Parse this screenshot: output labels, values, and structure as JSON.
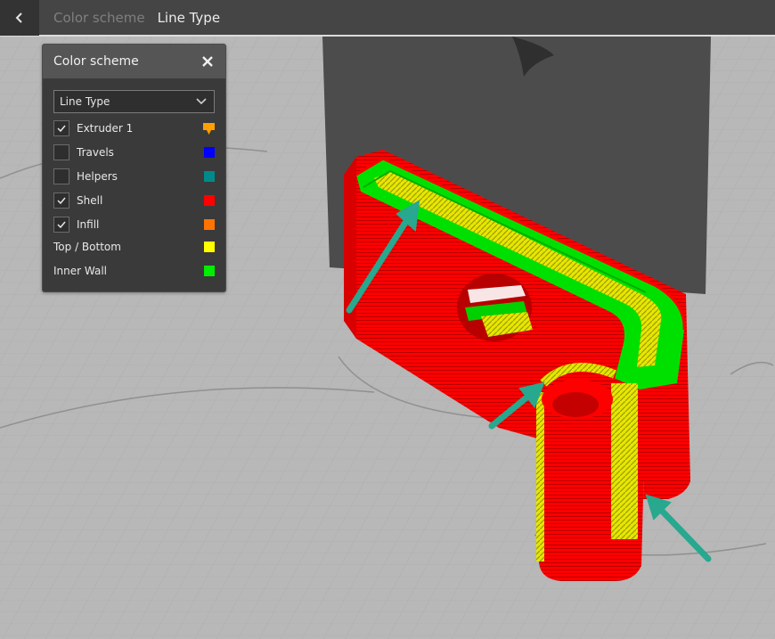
{
  "breadcrumb": {
    "parent": "Color scheme",
    "current": "Line Type"
  },
  "panel": {
    "title": "Color scheme",
    "dropdown_value": "Line Type",
    "items": [
      {
        "label": "Extruder 1",
        "checked": true,
        "color": "#ff9f00",
        "icon": "extruder-flag-icon"
      },
      {
        "label": "Travels",
        "checked": false,
        "color": "#0000ff"
      },
      {
        "label": "Helpers",
        "checked": false,
        "color": "#00898b"
      },
      {
        "label": "Shell",
        "checked": true,
        "color": "#ff0000"
      },
      {
        "label": "Infill",
        "checked": true,
        "color": "#ff7400"
      },
      {
        "label": "Top / Bottom",
        "color": "#ffff00"
      },
      {
        "label": "Inner Wall",
        "color": "#00ee00"
      }
    ]
  },
  "colors": {
    "topbar": "#454546",
    "panel_bg": "#3a3a3b",
    "build_plate": "#b7b8b7",
    "arrow": "#27a88f"
  }
}
